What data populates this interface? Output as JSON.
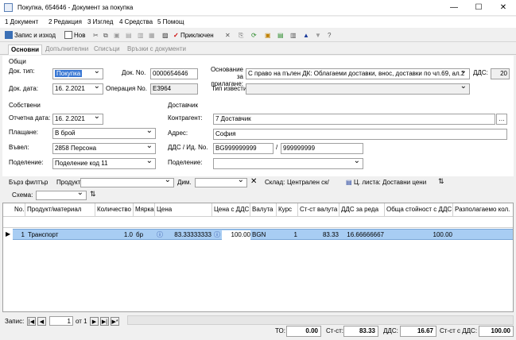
{
  "window": {
    "title": "Покупка, 654646 - Документ за покупка",
    "minimize": "—",
    "maximize": "☐",
    "close": "✕"
  },
  "menu": [
    "1 Документ",
    "2 Редакция",
    "3 Изглед",
    "4 Средства",
    "5 Помощ"
  ],
  "toolbar": {
    "save_exit": "Запис и изход",
    "new": "Нов",
    "confirmed": "Приключен"
  },
  "tabs": [
    "Основни",
    "Допълнителни",
    "Списъци",
    "Връзки с документи"
  ],
  "general": {
    "section": "Общи",
    "doc_type_label": "Док. тип:",
    "doc_type": "Покупка",
    "doc_no_label": "Док. No.",
    "doc_no": "0000654646",
    "basis_label": "Основание\nза прилагане:",
    "basis": "С право на пълен ДК: Облагаеми доставки, внос, доставки по чл.69, ал.2",
    "vat_label": "ДДС:",
    "vat": "20",
    "doc_date_label": "Док. дата:",
    "doc_date": "16.  2.2021",
    "op_no_label": "Операция No.",
    "op_no": "E3964",
    "notice_label": "Тип известие:"
  },
  "own": {
    "section": "Собствени",
    "report_date_label": "Отчетна дата:",
    "report_date": "16.  2.2021",
    "payment_label": "Плащане:",
    "payment": "В брой",
    "entered_label": "Въвел:",
    "entered": "2858 Персона",
    "division_label": "Поделение:",
    "division": "Поделение код 11"
  },
  "supplier": {
    "section": "Доставчик",
    "partner_label": "Контрагент:",
    "partner": "7 Доставчик",
    "address_label": "Адрес:",
    "address": "София",
    "vat_id_label": "ДДС / Ид. No.",
    "vat_id": "BG999999999",
    "id_sep": "/",
    "id_no": "999999999",
    "division_label": "Поделение:"
  },
  "filter": {
    "quick": "Бърз филтър",
    "product_label": "Продукт:",
    "dim_label": "Дим.",
    "store_label": "Склад:",
    "store": "Централен ск/",
    "price_list_label": "Ц. листа:",
    "price_list": "Доставни цени",
    "scheme_label": "Схема:"
  },
  "grid": {
    "columns": [
      "No.",
      "Продукт/материал",
      "Количество",
      "Мярка",
      "Цена",
      "Цена с ДДС",
      "Валута",
      "Курс",
      "Ст-ст валута",
      "ДДС за реда",
      "Обща стойност с ДДС",
      "Разполагаемо кол."
    ],
    "rows": [
      {
        "no": "1",
        "product": "Транспорт",
        "qty": "1.0",
        "unit": "бр",
        "price": "83.33333333",
        "price_vat": "100.00",
        "currency": "BGN",
        "rate": "1",
        "value_cur": "83.33",
        "vat_row": "16.66666667",
        "total_vat": "100.00",
        "available": ""
      }
    ]
  },
  "status": {
    "record_label": "Запис:",
    "record": "1",
    "of": "от 1",
    "to_label": "ТО:",
    "to": "0.00",
    "value_label": "Ст-ст:",
    "value": "83.33",
    "vat_label": "ДДС:",
    "vat": "16.67",
    "total_label": "Ст-ст с ДДС:",
    "total": "100.00"
  }
}
